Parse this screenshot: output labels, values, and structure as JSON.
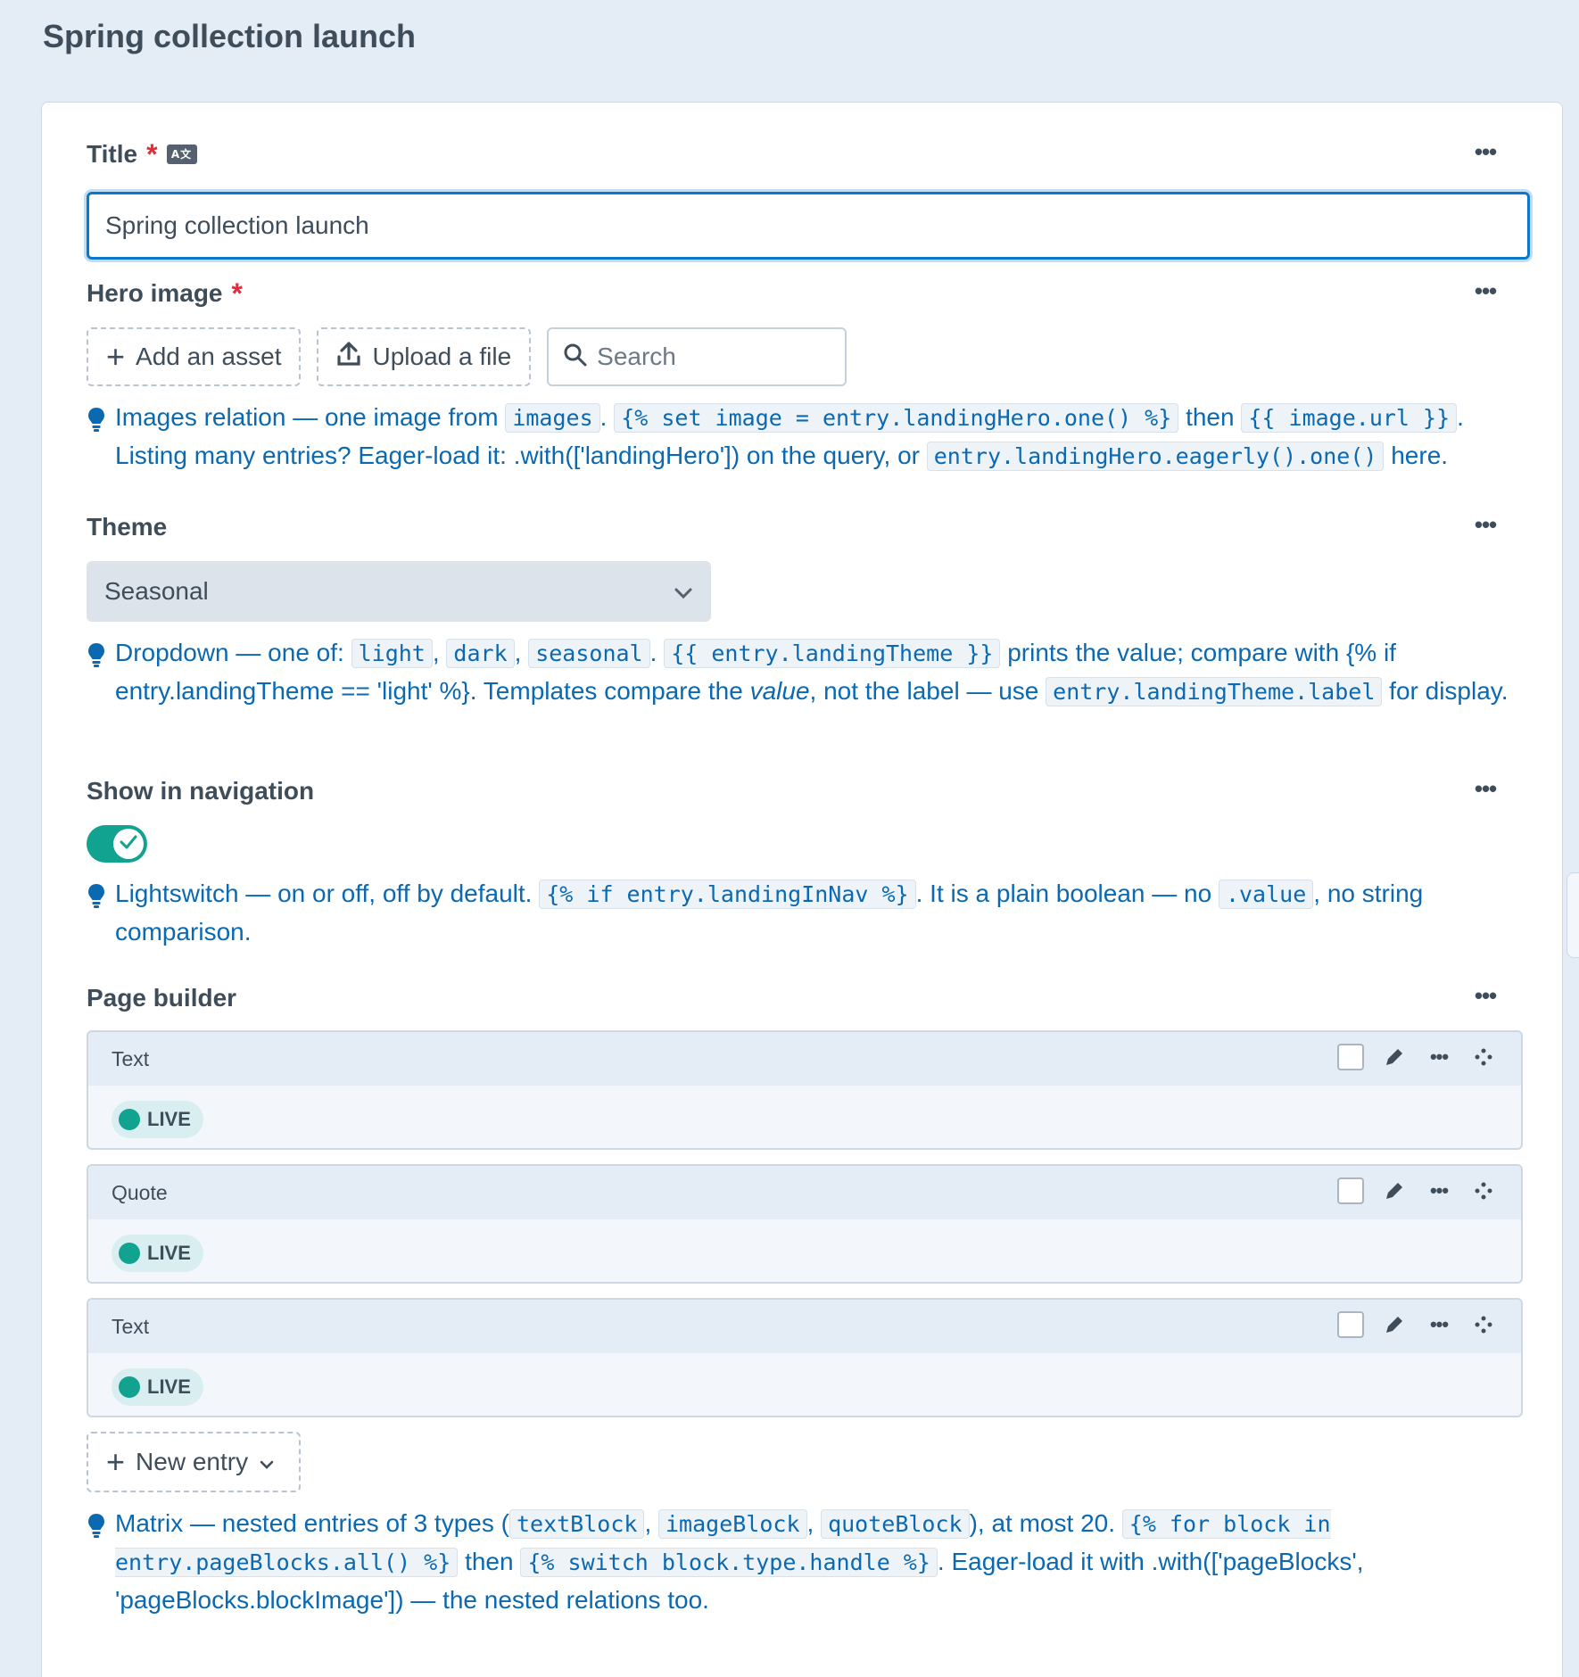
{
  "page": {
    "title": "Spring collection launch"
  },
  "fields": {
    "title": {
      "label": "Title",
      "required_mark": "*",
      "translatable_icon": "translate-icon",
      "value": "Spring collection launch"
    },
    "hero": {
      "label": "Hero image",
      "required_mark": "*",
      "add_asset": "Add an asset",
      "upload": "Upload a file",
      "search_placeholder": "Search",
      "hint": {
        "t1": "Images relation — one image from ",
        "c1": "images",
        "t2": ". ",
        "c2": "{% set image = entry.landingHero.one() %}",
        "t3": " then ",
        "c3": "{{ image.url }}",
        "t4": ". Listing many entries? Eager-load it: .with(['landingHero']) on the query, or ",
        "c4": "entry.landingHero.eagerly().one()",
        "t5": " here."
      }
    },
    "theme": {
      "label": "Theme",
      "selected": "Seasonal",
      "hint": {
        "t1": "Dropdown — one of: ",
        "c1": "light",
        "t2": ", ",
        "c2": "dark",
        "t3": ", ",
        "c3": "seasonal",
        "t4": ". ",
        "c4": "{{ entry.landingTheme }}",
        "t5": " prints the value; compare with {% if entry.landingTheme == 'light' %}. Templates compare the ",
        "em": "value",
        "t6": ", not the label — use ",
        "c5": "entry.landingTheme.label",
        "t7": " for display."
      }
    },
    "nav": {
      "label": "Show in navigation",
      "enabled": true,
      "hint": {
        "t1": "Lightswitch — on or off, off by default. ",
        "c1": "{% if entry.landingInNav %}",
        "t2": ". It is a plain boolean — no ",
        "c2": ".value",
        "t3": ", no string comparison."
      }
    },
    "builder": {
      "label": "Page builder",
      "blocks": [
        {
          "type": "Text",
          "status": "LIVE"
        },
        {
          "type": "Quote",
          "status": "LIVE"
        },
        {
          "type": "Text",
          "status": "LIVE"
        }
      ],
      "new_entry": "New entry",
      "hint": {
        "t1": "Matrix — nested entries of 3 types (",
        "c1": "textBlock",
        "t2": ", ",
        "c2": "imageBlock",
        "t3": ", ",
        "c3": "quoteBlock",
        "t4": "), at most 20. ",
        "c4": "{% for block in entry.pageBlocks.all() %}",
        "t5": " then ",
        "c5": "{% switch block.type.handle %}",
        "t6": ". Eager-load it with .with(['pageBlocks', 'pageBlocks.blockImage']) — the nested relations too."
      }
    }
  },
  "colors": {
    "accent": "#0d78c9",
    "hint": "#0b69b1",
    "live": "#11a38f",
    "required": "#e12d39",
    "page_bg": "#e4ecf6"
  }
}
